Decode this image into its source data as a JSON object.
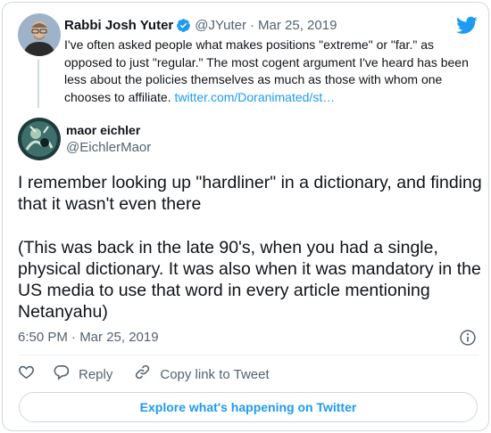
{
  "colors": {
    "accent": "#1d9bf0",
    "text": "#0f1419",
    "secondary": "#536471",
    "border": "#cfd9de"
  },
  "parent_tweet": {
    "author_name": "Rabbi Josh Yuter",
    "handle": "@JYuter",
    "separator": "·",
    "date": "Mar 25, 2019",
    "text": "I've often asked people what makes positions \"extreme\" or \"far.\" as opposed to just \"regular.\" The most cogent argument I've heard has been less about the policies themselves as much as those with whom one chooses to affiliate. ",
    "link": "twitter.com/Doranimated/st…",
    "verified_icon": "verified-badge-icon",
    "avatar_icon": "avatar"
  },
  "main_tweet": {
    "author_name": "maor eichler",
    "handle": "@EichlerMaor",
    "text": "I remember looking up \"hardliner\" in a dictionary, and finding that it wasn't even there\n\n(This was back in the late 90's, when you had a single, physical dictionary. It was also when it was mandatory in the US media to use that word in every article mentioning Netanyahu)",
    "timestamp": "6:50 PM · Mar 25, 2019"
  },
  "actions": {
    "like_icon": "heart-icon",
    "reply_label": "Reply",
    "reply_icon": "reply-icon",
    "copy_label": "Copy link to Tweet",
    "copy_icon": "link-icon"
  },
  "explore": {
    "label": "Explore what's happening on Twitter"
  },
  "brand_icon": "twitter-logo-icon",
  "info_icon": "info-icon"
}
